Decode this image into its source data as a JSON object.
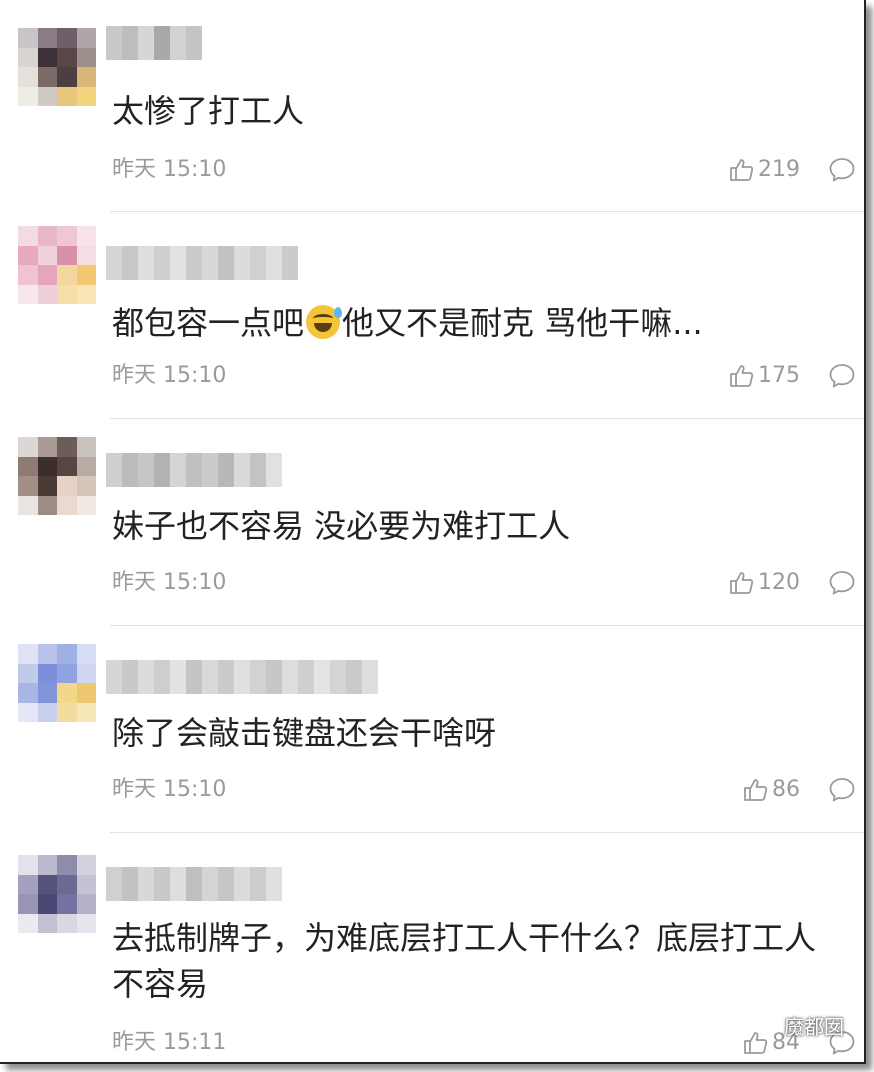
{
  "comments": [
    {
      "text": "太惨了打工人",
      "time": "昨天 15:10",
      "likes": "219",
      "avatar_colors": [
        "#c9c4c8",
        "#8a7d88",
        "#6f5f68",
        "#b0a5a8",
        "#d9d4d0",
        "#3d3036",
        "#5a4646",
        "#9c8f8c",
        "#e4e1da",
        "#7c6a66",
        "#4b3f3f",
        "#d8b879",
        "#f0ede4",
        "#cfcac4",
        "#e8c77b",
        "#f3d47c"
      ],
      "name_colors": [
        "#c9c9c9",
        "#bdbdbd",
        "#d6d6d6",
        "#a9a9a9",
        "#d2d2d2",
        "#c4c4c4"
      ]
    },
    {
      "text_before": "都包容一点吧",
      "emoji": "sweat-smile-emoji",
      "text_after": "他又不是耐克 骂他干嘛...",
      "time": "昨天 15:10",
      "likes": "175",
      "avatar_colors": [
        "#f3dbe2",
        "#e9b8c8",
        "#efc7d3",
        "#f6e4ea",
        "#e7a9bd",
        "#f1d1dc",
        "#d990a9",
        "#f5dde4",
        "#f0c3d1",
        "#e5a5bb",
        "#f4d6a1",
        "#f3c873",
        "#f7e8ee",
        "#efcfd9",
        "#f5dfa8",
        "#f9e6b6"
      ],
      "name_colors": [
        "#d4d4d4",
        "#c8c8c8",
        "#dedede",
        "#cfcfcf",
        "#e2e2e2",
        "#cacaca",
        "#d8d8d8",
        "#c2c2c2",
        "#dcdcdc",
        "#d0d0d0",
        "#e0e0e0",
        "#cbcbcb"
      ]
    },
    {
      "text": "妹子也不容易 没必要为难打工人",
      "time": "昨天 15:10",
      "likes": "120",
      "avatar_colors": [
        "#dcd7d4",
        "#a99a94",
        "#6d5d58",
        "#c9c1bd",
        "#8f7b74",
        "#3b2e2b",
        "#57463f",
        "#b8aba5",
        "#a18f88",
        "#4a3b36",
        "#e7d2c6",
        "#d7c5bc",
        "#e8e4e1",
        "#9c8c86",
        "#e9d9ce",
        "#f0e8e2"
      ],
      "name_colors": [
        "#cfcfcf",
        "#bcbcbc",
        "#c6c6c6",
        "#b3b3b3",
        "#d4d4d4",
        "#c0c0c0",
        "#cbcbcb",
        "#b8b8b8",
        "#d9d9d9",
        "#c3c3c3",
        "#e1e1e1"
      ]
    },
    {
      "text": "除了会敲击键盘还会干啥呀",
      "time": "昨天 15:10",
      "likes": "86",
      "avatar_colors": [
        "#dfe3f4",
        "#b8c2ea",
        "#9fb0e6",
        "#d6dcf2",
        "#c0cae9",
        "#7d8fd9",
        "#90a2e2",
        "#cfd6f0",
        "#a9b5e4",
        "#8394d9",
        "#f2d68a",
        "#edc870",
        "#e4e8f6",
        "#c8d0ee",
        "#f3dc9d",
        "#f7e6b8"
      ],
      "name_colors": [
        "#d6d6d6",
        "#c9c9c9",
        "#dcdcdc",
        "#cecece",
        "#e2e2e2",
        "#c4c4c4",
        "#d9d9d9",
        "#cbcbcb",
        "#e0e0e0",
        "#d2d2d2",
        "#c7c7c7",
        "#dddddd",
        "#cfcfcf",
        "#e4e4e4",
        "#d4d4d4",
        "#cacaca",
        "#dedede"
      ]
    },
    {
      "text_line1": "去抵制牌子，为难底层打工人干什么？底层打工人",
      "text_line2": "不容易",
      "time": "昨天 15:11",
      "likes": "84",
      "avatar_colors": [
        "#e3e2ea",
        "#b9b8cc",
        "#8e8cab",
        "#d2d1de",
        "#a3a1bd",
        "#55537d",
        "#6c6a92",
        "#c4c3d4",
        "#9794b4",
        "#4a4872",
        "#7472a0",
        "#b4b2c9",
        "#eceaf0",
        "#c2c0d2",
        "#d9d8e2",
        "#e6e5ec"
      ],
      "name_colors": [
        "#d0d0d0",
        "#c2c2c2",
        "#d8d8d8",
        "#c8c8c8",
        "#dedede",
        "#bfbfbf",
        "#d4d4d4",
        "#c6c6c6",
        "#dbdbdb",
        "#cccccc",
        "#e0e0e0"
      ]
    }
  ],
  "watermark": {
    "text": "魔都囡",
    "icon": "wechat-icon"
  },
  "colors": {
    "text": "#222222",
    "meta": "#9a9a9a",
    "divider": "#e3e3e3"
  }
}
